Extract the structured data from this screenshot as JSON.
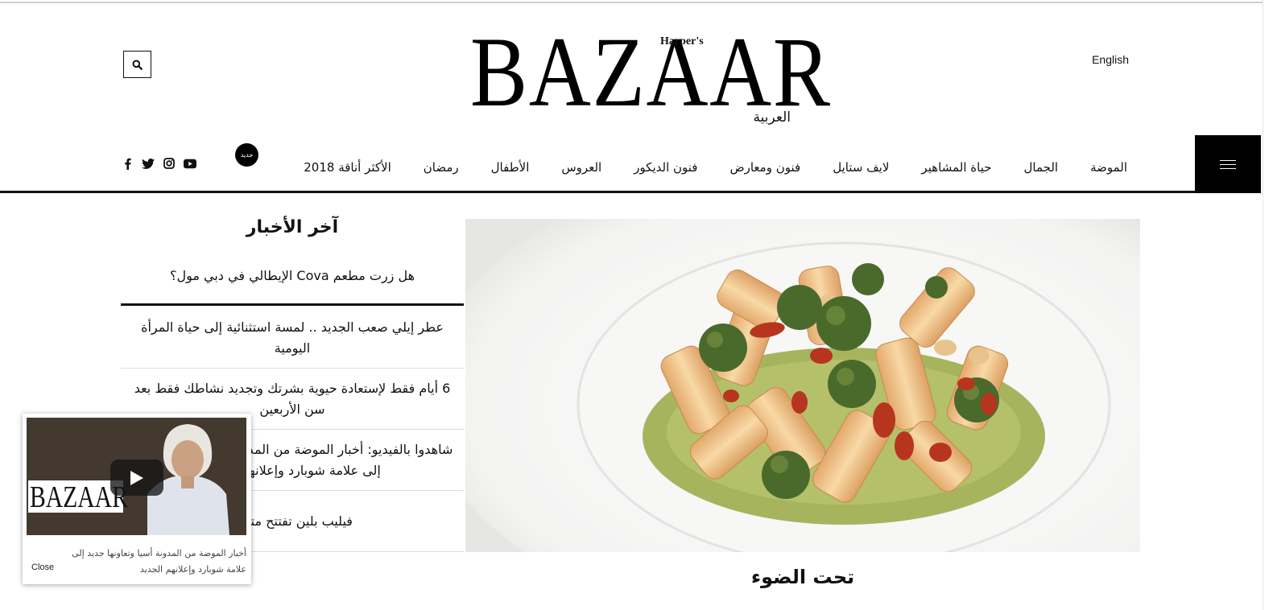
{
  "header": {
    "language_link": "English",
    "logo": {
      "word": "BAZAAR",
      "harpers": "Harper's",
      "arabic": "العربية"
    },
    "search_icon": "search-icon"
  },
  "nav": {
    "items": [
      "الموضة",
      "الجمال",
      "حياة المشاهير",
      "لايف ستايل",
      "فنون ومعارض",
      "فنون الديكور",
      "العروس",
      "الأطفال",
      "رمضان",
      "الأكثر أناقة 2018"
    ],
    "new_badge": "جديد",
    "menu_icon": "hamburger-menu-icon",
    "social_icons": [
      "facebook-icon",
      "twitter-icon",
      "instagram-icon",
      "youtube-icon"
    ]
  },
  "latest_news": {
    "title": "آخر الأخبار",
    "featured": "هل زرت مطعم Cova الإيطالي في دبي مول؟",
    "items": [
      "عطر إيلي صعب الجديد .. لمسة استثنائية إلى حياة المرأة اليومية",
      "6 أيام فقط لإستعادة حيوية بشرتك وتجديد نشاطك فقط بعد سن الأربعين",
      "شاهدوا بالفيديو: أخبار الموضة من المدونة أسيا وتعاونها جديد إلى علامة شوبارد وإعلانهم الجديد",
      "فيليب بلين تفتتح متجراً"
    ]
  },
  "hero": {
    "section_title": "تحت الضوء",
    "image_subject": "rigatoni pasta with broccoli and sun-dried tomatoes on green pesto in a white bowl"
  },
  "video_popup": {
    "logo_word": "BAZAAR",
    "caption": "أخبار الموضة من المدونة أسيا وتعاونها جديد إلى علامة شوبارد وإعلانهم الجديد",
    "close_label": "Close",
    "play_icon": "play-icon"
  },
  "colors": {
    "text": "#111111",
    "menu_bg": "#000000",
    "divider": "#dcdcdc"
  }
}
